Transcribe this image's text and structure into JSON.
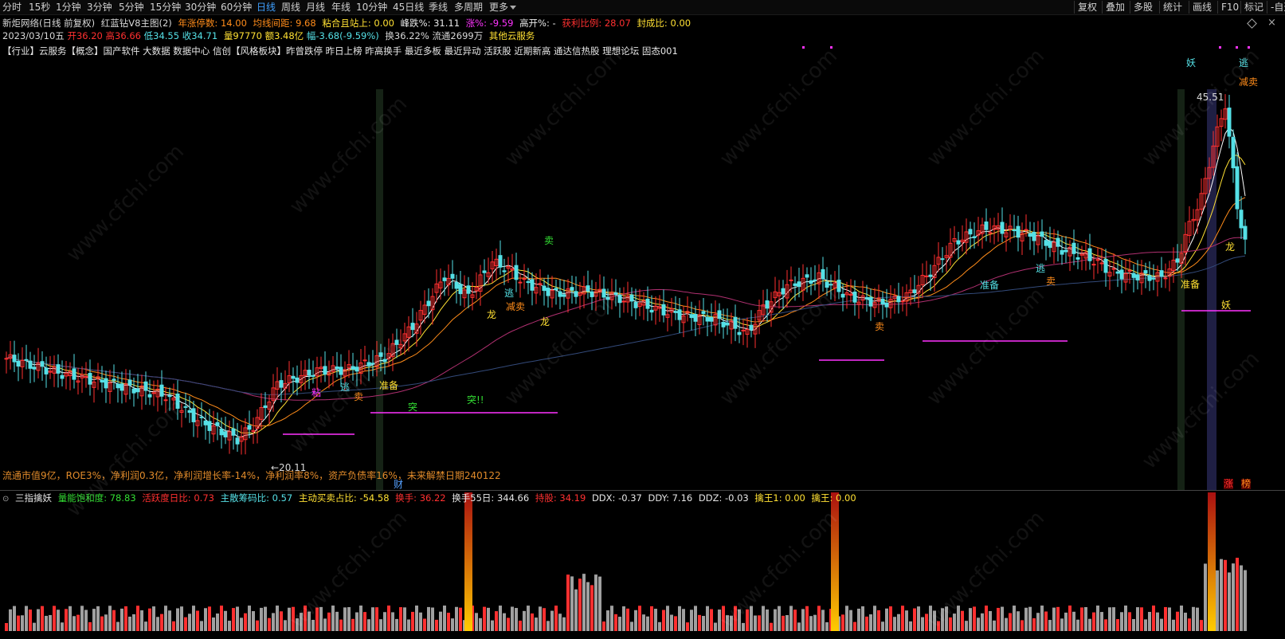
{
  "colors": {
    "up": "#ff3030",
    "down": "#55e0e6",
    "magenta": "#ff33ff",
    "orange": "#ff8c1a",
    "yellow": "#ffe033",
    "gray": "#8a8a8a"
  },
  "period_tabs": [
    "分时",
    "15秒",
    "1分钟",
    "3分钟",
    "5分钟",
    "15分钟",
    "30分钟",
    "60分钟",
    "日线",
    "周线",
    "月线",
    "年线",
    "10分钟",
    "45日线",
    "季线",
    "多周期",
    "更多"
  ],
  "active_tab": "日线",
  "right_buttons": [
    "复权",
    "叠加",
    "多股",
    "统计",
    "画线",
    "F10",
    "标记",
    "-自选"
  ],
  "header": {
    "stock": "新炬网络(日线 前复权)",
    "indicator": "红蓝钻V8主图(2)",
    "zt_label": "年涨停数: 14.00",
    "jxjj_label": "均线间距: 9.68",
    "zhsz_label": "粘合且站上: 0.00",
    "fd_label": "峰跌%: 31.11",
    "zhang_label": "涨%: -9.59",
    "gk_label": "高开%: -",
    "hl_label": "获利比例: 28.07",
    "fcb_label": "封成比: 0.00"
  },
  "quote": {
    "date": "2023/03/10五",
    "open": "开36.20",
    "high": "高36.66",
    "low": "低34.55",
    "close": "收34.71",
    "vol": "量97770",
    "amt": "额3.48亿",
    "chg": "幅-3.68(-9.59%)",
    "turn": "换36.22%",
    "float": "流通2699万",
    "cat": "其他云服务"
  },
  "concepts": "【行业】云服务【概念】国产软件 大数据 数据中心 信创【风格板块】昨曾跌停 昨日上榜 昨高换手 最近多板 最近异动 活跃股 近期新高 通达信热股 理想论坛 固态001",
  "fundamental_note": "流通市值9亿，ROE3%，净利润0.3亿，净利润增长率-14%，净利润率8%，资产负债率16%，未来解禁日期240122",
  "price_labels": {
    "high": "45.51",
    "low": "←20.11",
    "cai": "财",
    "zhang_badge": "涨",
    "pin_badge": "榜"
  },
  "sub": {
    "title": "三指擒妖",
    "lnbhd": "量能饱和度: 78.83",
    "hydrb": "活跃度日比: 0.73",
    "zscmb": "主散筹码比: 0.57",
    "zdmmzb": "主动买卖占比: -54.58",
    "hs": "换手: 36.22",
    "hs55": "换手55日: 344.66",
    "cg": "持股: 34.19",
    "ddx": "DDX: -0.37",
    "ddy": "DDY: 7.16",
    "ddz": "DDZ: -0.03",
    "qw1": "擒王1: 0.00",
    "qw": "擒王: 0.00"
  },
  "signals": [
    "逃",
    "卖",
    "准备",
    "突!!",
    "龙",
    "减卖",
    "逃",
    "卖",
    "粘",
    "突",
    "逃",
    "卖",
    "准备",
    "龙",
    "妖",
    "逃",
    "减卖"
  ],
  "watermark": "www.cfchi.com"
}
